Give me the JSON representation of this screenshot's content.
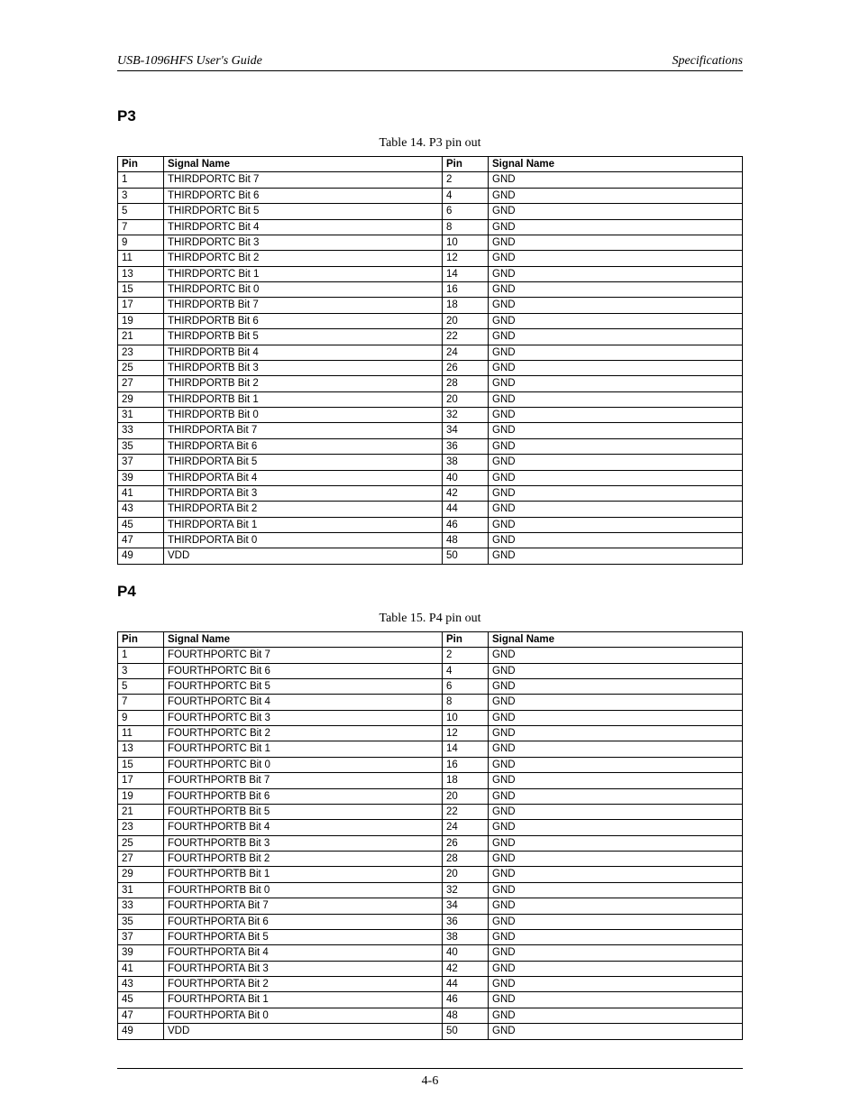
{
  "header": {
    "left": "USB-1096HFS User's Guide",
    "right": "Specifications"
  },
  "sections": {
    "p3": {
      "title": "P3",
      "caption": "Table 14. P3 pin out",
      "columns": [
        "Pin",
        "Signal Name",
        "Pin",
        "Signal Name"
      ],
      "rows": [
        [
          "1",
          "THIRDPORTC Bit 7",
          "2",
          "GND"
        ],
        [
          "3",
          "THIRDPORTC Bit 6",
          "4",
          "GND"
        ],
        [
          "5",
          "THIRDPORTC Bit 5",
          "6",
          "GND"
        ],
        [
          "7",
          "THIRDPORTC Bit 4",
          "8",
          "GND"
        ],
        [
          "9",
          "THIRDPORTC Bit 3",
          "10",
          "GND"
        ],
        [
          "11",
          "THIRDPORTC Bit 2",
          "12",
          "GND"
        ],
        [
          "13",
          "THIRDPORTC Bit 1",
          "14",
          "GND"
        ],
        [
          "15",
          "THIRDPORTC Bit 0",
          "16",
          "GND"
        ],
        [
          "17",
          "THIRDPORTB Bit 7",
          "18",
          "GND"
        ],
        [
          "19",
          "THIRDPORTB Bit 6",
          "20",
          "GND"
        ],
        [
          "21",
          "THIRDPORTB Bit 5",
          "22",
          "GND"
        ],
        [
          "23",
          "THIRDPORTB Bit 4",
          "24",
          "GND"
        ],
        [
          "25",
          "THIRDPORTB Bit 3",
          "26",
          "GND"
        ],
        [
          "27",
          "THIRDPORTB Bit 2",
          "28",
          "GND"
        ],
        [
          "29",
          "THIRDPORTB Bit 1",
          "20",
          "GND"
        ],
        [
          "31",
          "THIRDPORTB Bit 0",
          "32",
          "GND"
        ],
        [
          "33",
          "THIRDPORTA Bit 7",
          "34",
          "GND"
        ],
        [
          "35",
          "THIRDPORTA Bit 6",
          "36",
          "GND"
        ],
        [
          "37",
          "THIRDPORTA Bit 5",
          "38",
          "GND"
        ],
        [
          "39",
          "THIRDPORTA Bit 4",
          "40",
          "GND"
        ],
        [
          "41",
          "THIRDPORTA Bit 3",
          "42",
          "GND"
        ],
        [
          "43",
          "THIRDPORTA Bit 2",
          "44",
          "GND"
        ],
        [
          "45",
          "THIRDPORTA Bit 1",
          "46",
          "GND"
        ],
        [
          "47",
          "THIRDPORTA Bit 0",
          "48",
          "GND"
        ],
        [
          "49",
          "VDD",
          "50",
          "GND"
        ]
      ]
    },
    "p4": {
      "title": "P4",
      "caption": "Table 15. P4 pin out",
      "columns": [
        "Pin",
        "Signal Name",
        "Pin",
        "Signal Name"
      ],
      "rows": [
        [
          "1",
          "FOURTHPORTC Bit 7",
          "2",
          "GND"
        ],
        [
          "3",
          "FOURTHPORTC Bit 6",
          "4",
          "GND"
        ],
        [
          "5",
          "FOURTHPORTC Bit 5",
          "6",
          "GND"
        ],
        [
          "7",
          "FOURTHPORTC Bit 4",
          "8",
          "GND"
        ],
        [
          "9",
          "FOURTHPORTC Bit 3",
          "10",
          "GND"
        ],
        [
          "11",
          "FOURTHPORTC Bit 2",
          "12",
          "GND"
        ],
        [
          "13",
          "FOURTHPORTC Bit 1",
          "14",
          "GND"
        ],
        [
          "15",
          "FOURTHPORTC Bit 0",
          "16",
          "GND"
        ],
        [
          "17",
          "FOURTHPORTB Bit 7",
          "18",
          "GND"
        ],
        [
          "19",
          "FOURTHPORTB Bit 6",
          "20",
          "GND"
        ],
        [
          "21",
          "FOURTHPORTB Bit 5",
          "22",
          "GND"
        ],
        [
          "23",
          "FOURTHPORTB Bit 4",
          "24",
          "GND"
        ],
        [
          "25",
          "FOURTHPORTB Bit 3",
          "26",
          "GND"
        ],
        [
          "27",
          "FOURTHPORTB Bit 2",
          "28",
          "GND"
        ],
        [
          "29",
          "FOURTHPORTB Bit 1",
          "20",
          "GND"
        ],
        [
          "31",
          "FOURTHPORTB Bit 0",
          "32",
          "GND"
        ],
        [
          "33",
          "FOURTHPORTA Bit 7",
          "34",
          "GND"
        ],
        [
          "35",
          "FOURTHPORTA Bit 6",
          "36",
          "GND"
        ],
        [
          "37",
          "FOURTHPORTA Bit 5",
          "38",
          "GND"
        ],
        [
          "39",
          "FOURTHPORTA Bit 4",
          "40",
          "GND"
        ],
        [
          "41",
          "FOURTHPORTA Bit 3",
          "42",
          "GND"
        ],
        [
          "43",
          "FOURTHPORTA Bit 2",
          "44",
          "GND"
        ],
        [
          "45",
          "FOURTHPORTA Bit 1",
          "46",
          "GND"
        ],
        [
          "47",
          "FOURTHPORTA Bit 0",
          "48",
          "GND"
        ],
        [
          "49",
          "VDD",
          "50",
          "GND"
        ]
      ]
    }
  },
  "page_number": "4-6"
}
